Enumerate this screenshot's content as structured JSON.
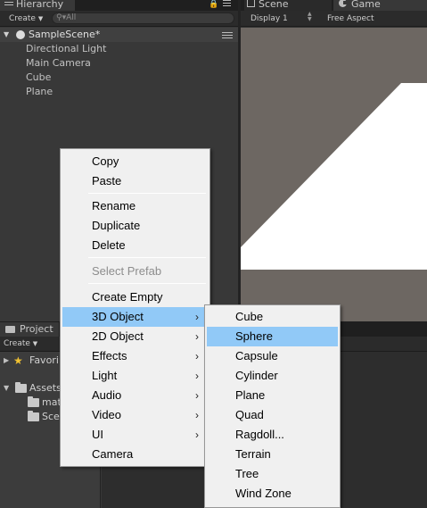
{
  "hierarchy": {
    "tab_label": "Hierarchy",
    "create_label": "Create",
    "search_placeholder": "All",
    "scene_name": "SampleScene*",
    "items": [
      "Directional Light",
      "Main Camera",
      "Cube",
      "Plane"
    ]
  },
  "game": {
    "scene_tab": "Scene",
    "game_tab": "Game",
    "display": "Display 1",
    "aspect": "Free Aspect"
  },
  "project": {
    "tab_label": "Project",
    "create_label": "Create",
    "favorites": "Favori",
    "assets": "Assets",
    "child1": "mat",
    "child2": "Scer"
  },
  "context_menu": {
    "copy": "Copy",
    "paste": "Paste",
    "rename": "Rename",
    "duplicate": "Duplicate",
    "delete": "Delete",
    "select_prefab": "Select Prefab",
    "create_empty": "Create Empty",
    "object_3d": "3D Object",
    "object_2d": "2D Object",
    "effects": "Effects",
    "light": "Light",
    "audio": "Audio",
    "video": "Video",
    "ui": "UI",
    "camera": "Camera"
  },
  "submenu": {
    "cube": "Cube",
    "sphere": "Sphere",
    "capsule": "Capsule",
    "cylinder": "Cylinder",
    "plane": "Plane",
    "quad": "Quad",
    "ragdoll": "Ragdoll...",
    "terrain": "Terrain",
    "tree": "Tree",
    "wind_zone": "Wind Zone"
  },
  "colors": {
    "highlight": "#91c9f7",
    "panel_bg": "#383838",
    "game_bg": "#6d6762"
  }
}
